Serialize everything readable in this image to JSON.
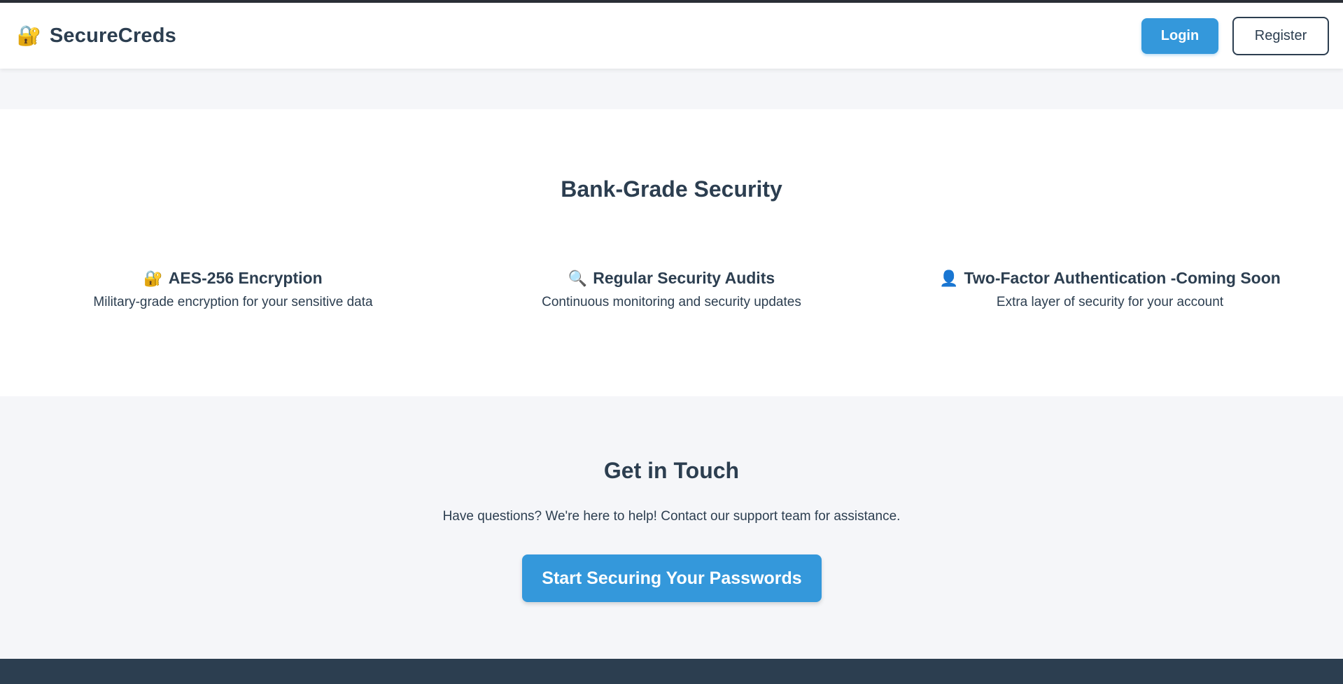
{
  "header": {
    "brand_icon": "🔐",
    "brand_name": "SecureCreds",
    "login_label": "Login",
    "register_label": "Register"
  },
  "security": {
    "title": "Bank-Grade Security",
    "features": [
      {
        "icon": "🔐",
        "icon_name": "lock-icon",
        "title": "AES-256 Encryption",
        "description": "Military-grade encryption for your sensitive data"
      },
      {
        "icon": "🔍",
        "icon_name": "magnifier-icon",
        "title": "Regular Security Audits",
        "description": "Continuous monitoring and security updates"
      },
      {
        "icon": "👤",
        "icon_name": "user-icon",
        "title": "Two-Factor Authentication -Coming Soon",
        "description": "Extra layer of security for your account"
      }
    ]
  },
  "contact": {
    "title": "Get in Touch",
    "text": "Have questions? We're here to help! Contact our support team for assistance.",
    "cta_label": "Start Securing Your Passwords"
  },
  "colors": {
    "primary": "#3498db",
    "dark": "#2c3e50",
    "light_bg": "#f5f6f9"
  }
}
